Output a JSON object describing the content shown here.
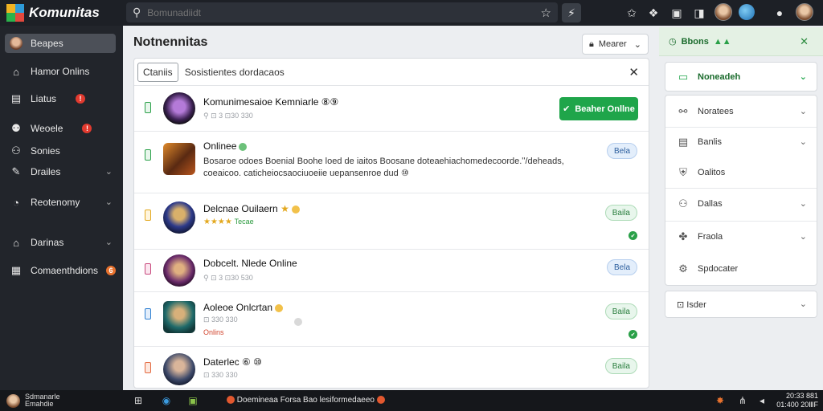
{
  "app": {
    "name": "Komunitas"
  },
  "search": {
    "placeholder": "Bomunadiidt"
  },
  "sidebar": {
    "items": [
      {
        "label": "Beapes",
        "icon": "avatar"
      },
      {
        "label": "Hamor Onlins",
        "icon": "home-icon"
      },
      {
        "label": "Liatus",
        "icon": "building-icon",
        "badge": "!"
      },
      {
        "label": "Weoele",
        "icon": "people-icon",
        "badge": "!"
      },
      {
        "label": "Sonies",
        "icon": "group-icon"
      },
      {
        "label": "Drailes",
        "icon": "tools-icon"
      },
      {
        "label": "Reotenomy",
        "icon": "chart-icon"
      },
      {
        "label": "Darinas",
        "icon": "home-icon"
      },
      {
        "label": "Comaenthdions",
        "icon": "list-icon",
        "badge": "6"
      }
    ]
  },
  "main": {
    "title": "Notnennitas",
    "sort_label": "Mearer",
    "panel": {
      "chip": "Ctaniis",
      "subtitle": "Sosistientes dordacaos"
    },
    "rows": [
      {
        "name": "Komunimesaioe Kemniarle ⑧⑨",
        "meta": "⚲ ⊡ 3 ⊡30 330",
        "action": "Beaher Onllne"
      },
      {
        "name": "Onlinee",
        "desc1": "Bosaroe odoes Boenial Boohe loed de iaitos Boosane doteaehiachomedecoorde.ʹʹ/deheads,",
        "desc2": "coeaicoo. caticheiocsaociuoeiie uepansenroe dud ⑩",
        "pill": "Bela"
      },
      {
        "name": "Delcnae Ouilaern",
        "stars": "★★★★",
        "stars_label": "Tecae",
        "pill": "Baila"
      },
      {
        "name": "Dobcelt. Nlede Online",
        "meta": "⚲ ⊡ 3 ⊡30 530",
        "pill": "Bela"
      },
      {
        "name": "Aoleoe Onlcrtan",
        "meta": "⊡ 330 330",
        "online": "Onlins",
        "pill": "Baila"
      },
      {
        "name": "Daterlec ⑥ ⑩",
        "meta": "⊡ 330 330",
        "pill": "Baila"
      }
    ]
  },
  "right": {
    "top_label": "Bbons",
    "selected": "Noneadeh",
    "items": [
      {
        "label": "Noratees",
        "icon": "sitemap-icon",
        "chevron": true
      },
      {
        "label": "Banlis",
        "icon": "calendar-icon",
        "chevron": true
      },
      {
        "label": "Oalitos",
        "icon": "shield-icon",
        "chevron": false
      },
      {
        "label": "Dallas",
        "icon": "users-icon",
        "chevron": true
      },
      {
        "label": "Fraola",
        "icon": "puzzle-icon",
        "chevron": true
      },
      {
        "label": "Spdocater",
        "icon": "settings-icon",
        "chevron": false
      }
    ],
    "footer": "⊡ Isder"
  },
  "taskbar": {
    "user_line1": "Sdmanarle",
    "user_line2": "Emahdie",
    "text": "Doemineaa Forsa Bao lesiformedaeeo",
    "clock_line1": "20:33 881",
    "clock_line2": "01:400 20ⅢF"
  }
}
